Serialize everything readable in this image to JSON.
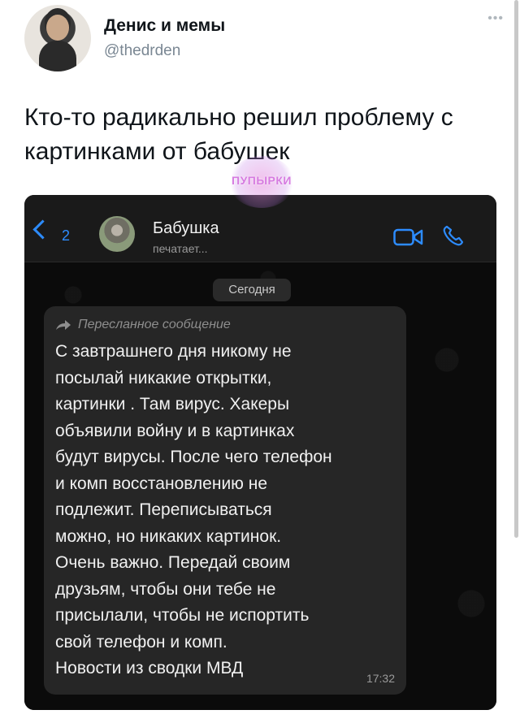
{
  "tweet": {
    "author_name": "Денис и мемы",
    "author_handle": "@thedrden",
    "text": "Кто-то радикально решил проблему с картинками от бабушек",
    "watermark": "ПУПЫРКИ"
  },
  "chat": {
    "back_count": "2",
    "contact_name": "Бабушка",
    "contact_status": "печатает...",
    "date_separator": "Сегодня",
    "message": {
      "forwarded_label": "Пересланное сообщение",
      "text": "С завтрашнего дня никому не\nпосылай никакие открытки,\nкартинки .  Там вирус.  Хакеры\nобъявили войну и в картинках\nбудут вирусы. После чего телефон\nи комп восстановлению не\nподлежит.  Переписываться\nможно, но  никаких картинок.\nОчень важно.  Передай своим\nдрузьям, чтобы они тебе не\nприсылали, чтобы не испортить\nсвой телефон и комп.\nНовости из сводки МВД",
      "time": "17:32"
    }
  },
  "colors": {
    "accent": "#2d8cff",
    "bubble": "#262626",
    "chat_bg": "#0b0b0b",
    "watermark": "#d67be0"
  },
  "icons": [
    "more-icon",
    "back-chevron-icon",
    "video-call-icon",
    "phone-call-icon",
    "forward-arrow-icon"
  ]
}
